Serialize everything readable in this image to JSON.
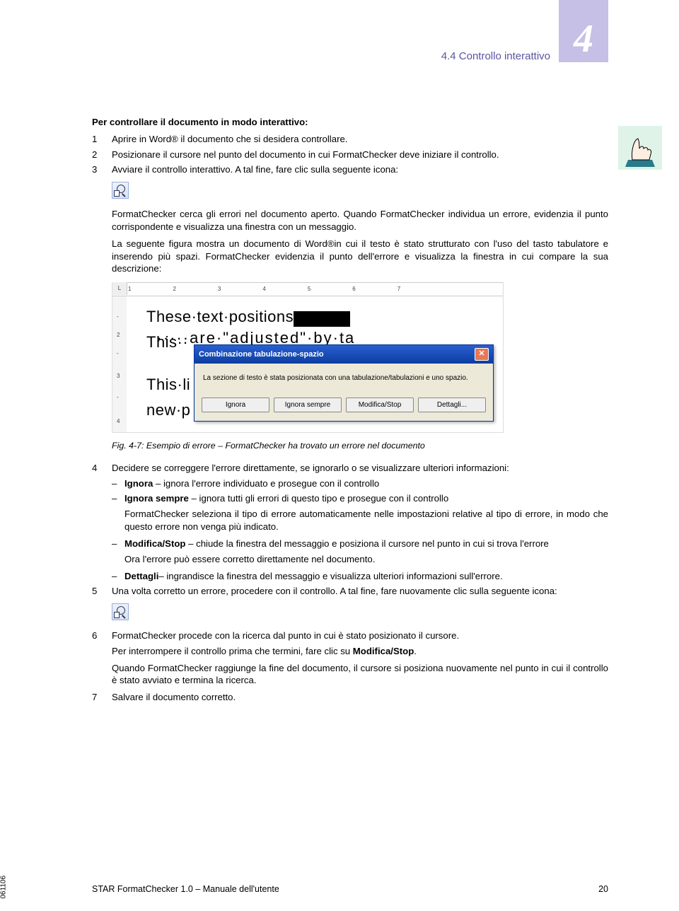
{
  "header": {
    "chapter_number": "4",
    "section_label": "4.4 Controllo interattivo"
  },
  "intro_title": "Per controllare il documento in modo interattivo:",
  "steps": {
    "1": "Aprire in Word® il documento che si desidera controllare.",
    "2": "Posizionare il cursore nel punto del documento in cui FormatChecker deve iniziare il controllo.",
    "3": "Avviare il controllo interattivo. A tal fine, fare clic sulla seguente icona:",
    "after3_p1": "FormatChecker cerca gli errori nel documento aperto. Quando FormatChecker individua un errore, evidenzia il punto corrispondente e visualizza una finestra con un messaggio.",
    "after3_p2": "La seguente figura mostra un documento di Word®in cui il testo è stato strutturato con l'uso del tasto tabulatore e inserendo più spazi. FormatChecker evidenzia il punto dell'errore e visualizza la finestra in cui compare la sua descrizione:",
    "4": "Decidere se correggere l'errore direttamente, se ignorarlo o se visualizzare ulteriori informazioni:",
    "5": "Una volta corretto un errore, procedere con il controllo. A tal fine, fare nuovamente clic sulla seguente icona:",
    "6a": "FormatChecker procede con la ricerca dal punto in cui è stato posizionato il cursore.",
    "6b_pre": "Per interrompere il controllo prima che termini, fare clic su ",
    "6b_bold": "Modifica/Stop",
    "6b_post": ".",
    "6c": "Quando FormatChecker raggiunge la fine del documento, il cursore si posiziona nuovamente nel punto in cui il controllo è stato avviato e termina la ricerca.",
    "7": "Salvare il documento corretto."
  },
  "bullets": {
    "ignora_label": "Ignora",
    "ignora_text": " – ignora l'errore individuato e prosegue con il controllo",
    "ignora_sempre_label": "Ignora sempre",
    "ignora_sempre_text": " – ignora tutti gli errori di questo tipo e prosegue con il controllo",
    "ignora_sempre_sub": "FormatChecker seleziona il tipo di errore automaticamente nelle impostazioni relative al tipo di errore, in modo che questo errore non venga più indicato.",
    "modifica_label": "Modifica/Stop",
    "modifica_text": " – chiude la finestra del messaggio e posiziona il cursore nel punto in cui si trova l'errore",
    "modifica_sub": "Ora l'errore può essere corretto direttamente nel documento.",
    "dettagli_label": "Dettagli",
    "dettagli_text": "– ingrandisce la finestra del messaggio e visualizza ulteriori informazioni sull'errore."
  },
  "figure": {
    "ruler_pre": "L",
    "ruler_marks": [
      "1",
      "2",
      "3",
      "4",
      "5",
      "6",
      "7"
    ],
    "vruler": {
      "t1": "-",
      "t2": "2",
      "t3": "-",
      "t4": "3",
      "t5": "-",
      "t6": "4"
    },
    "line1_a": "These·text·positions",
    "line1_b": "·····are·\"adjusted\"·by·ta",
    "arrow": "→",
    "line2": "This··",
    "line3": "This·li",
    "line4": "new·p",
    "dialog_title": "Combinazione tabulazione-spazio",
    "dialog_body": "La sezione di testo è stata posizionata con una tabulazione/tabulazioni e uno spazio.",
    "buttons": {
      "ignora": "Ignora",
      "ignora_sempre": "Ignora sempre",
      "modifica": "Modifica/Stop",
      "dettagli": "Dettagli..."
    },
    "caption": "Fig. 4-7: Esempio di errore – FormatChecker ha trovato un errore nel documento"
  },
  "footer": {
    "left": "STAR FormatChecker 1.0 – Manuale dell'utente",
    "right": "20"
  },
  "side_code": "061106"
}
